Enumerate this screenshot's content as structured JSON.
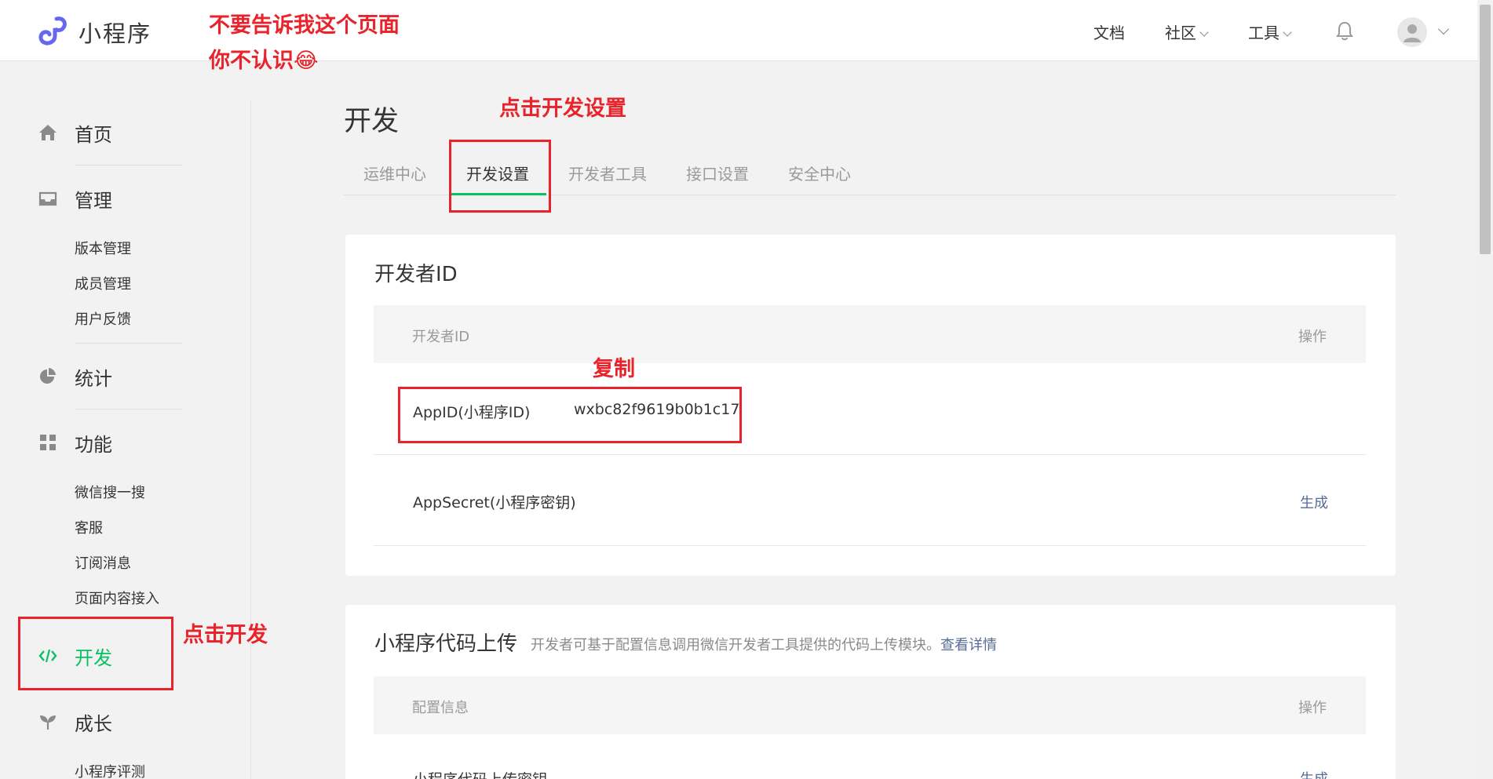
{
  "app": {
    "brand": "小程序"
  },
  "topnav": {
    "docs": "文档",
    "community": "社区",
    "tools": "工具"
  },
  "sidebar": {
    "home": "首页",
    "manage": "管理",
    "manage_items": [
      "版本管理",
      "成员管理",
      "用户反馈"
    ],
    "stats": "统计",
    "features": "功能",
    "feature_items": [
      "微信搜一搜",
      "客服",
      "订阅消息",
      "页面内容接入"
    ],
    "develop": "开发",
    "growth": "成长",
    "growth_items": [
      "小程序评测"
    ]
  },
  "page": {
    "title": "开发",
    "tabs": [
      "运维中心",
      "开发设置",
      "开发者工具",
      "接口设置",
      "安全中心"
    ],
    "active_tab": "开发设置"
  },
  "dev_id_card": {
    "title": "开发者ID",
    "header_col": "开发者ID",
    "header_action": "操作",
    "appid_label": "AppID(小程序ID)",
    "appid_value": "wxbc82f9619b0b1c17",
    "secret_label": "AppSecret(小程序密钥)",
    "secret_action": "生成"
  },
  "upload_card": {
    "title": "小程序代码上传",
    "desc": "开发者可基于配置信息调用微信开发者工具提供的代码上传模块。",
    "desc_link": "查看详情",
    "header_col": "配置信息",
    "header_action": "操作",
    "row_label": "小程序代码上传密钥",
    "row_action": "生成"
  },
  "annotations": {
    "top_line1": "不要告诉我这个页面",
    "top_line2": "你不认识😂",
    "click_dev_settings": "点击开发设置",
    "copy": "复制",
    "click_dev": "点击开发"
  },
  "colors": {
    "accent_green": "#07c160",
    "annotation_red": "#e8232b",
    "link_blue": "#576b95"
  }
}
